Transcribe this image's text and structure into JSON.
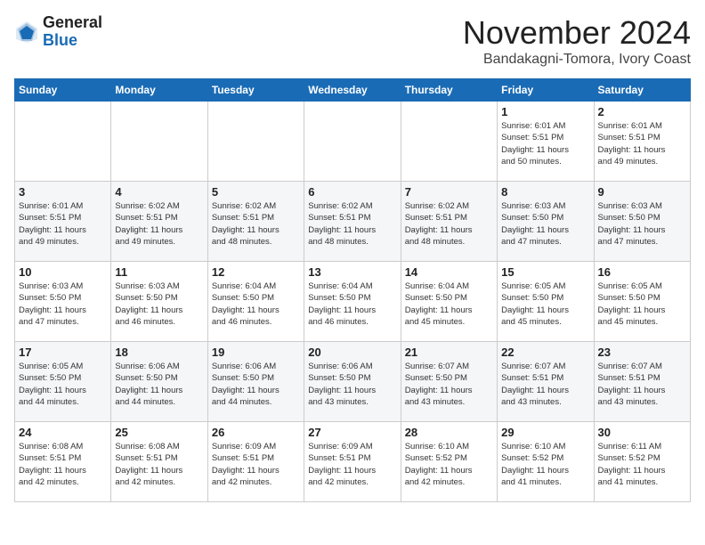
{
  "header": {
    "logo_general": "General",
    "logo_blue": "Blue",
    "month_title": "November 2024",
    "location": "Bandakagni-Tomora, Ivory Coast"
  },
  "weekdays": [
    "Sunday",
    "Monday",
    "Tuesday",
    "Wednesday",
    "Thursday",
    "Friday",
    "Saturday"
  ],
  "weeks": [
    [
      {
        "day": "",
        "info": ""
      },
      {
        "day": "",
        "info": ""
      },
      {
        "day": "",
        "info": ""
      },
      {
        "day": "",
        "info": ""
      },
      {
        "day": "",
        "info": ""
      },
      {
        "day": "1",
        "info": "Sunrise: 6:01 AM\nSunset: 5:51 PM\nDaylight: 11 hours\nand 50 minutes."
      },
      {
        "day": "2",
        "info": "Sunrise: 6:01 AM\nSunset: 5:51 PM\nDaylight: 11 hours\nand 49 minutes."
      }
    ],
    [
      {
        "day": "3",
        "info": "Sunrise: 6:01 AM\nSunset: 5:51 PM\nDaylight: 11 hours\nand 49 minutes."
      },
      {
        "day": "4",
        "info": "Sunrise: 6:02 AM\nSunset: 5:51 PM\nDaylight: 11 hours\nand 49 minutes."
      },
      {
        "day": "5",
        "info": "Sunrise: 6:02 AM\nSunset: 5:51 PM\nDaylight: 11 hours\nand 48 minutes."
      },
      {
        "day": "6",
        "info": "Sunrise: 6:02 AM\nSunset: 5:51 PM\nDaylight: 11 hours\nand 48 minutes."
      },
      {
        "day": "7",
        "info": "Sunrise: 6:02 AM\nSunset: 5:51 PM\nDaylight: 11 hours\nand 48 minutes."
      },
      {
        "day": "8",
        "info": "Sunrise: 6:03 AM\nSunset: 5:50 PM\nDaylight: 11 hours\nand 47 minutes."
      },
      {
        "day": "9",
        "info": "Sunrise: 6:03 AM\nSunset: 5:50 PM\nDaylight: 11 hours\nand 47 minutes."
      }
    ],
    [
      {
        "day": "10",
        "info": "Sunrise: 6:03 AM\nSunset: 5:50 PM\nDaylight: 11 hours\nand 47 minutes."
      },
      {
        "day": "11",
        "info": "Sunrise: 6:03 AM\nSunset: 5:50 PM\nDaylight: 11 hours\nand 46 minutes."
      },
      {
        "day": "12",
        "info": "Sunrise: 6:04 AM\nSunset: 5:50 PM\nDaylight: 11 hours\nand 46 minutes."
      },
      {
        "day": "13",
        "info": "Sunrise: 6:04 AM\nSunset: 5:50 PM\nDaylight: 11 hours\nand 46 minutes."
      },
      {
        "day": "14",
        "info": "Sunrise: 6:04 AM\nSunset: 5:50 PM\nDaylight: 11 hours\nand 45 minutes."
      },
      {
        "day": "15",
        "info": "Sunrise: 6:05 AM\nSunset: 5:50 PM\nDaylight: 11 hours\nand 45 minutes."
      },
      {
        "day": "16",
        "info": "Sunrise: 6:05 AM\nSunset: 5:50 PM\nDaylight: 11 hours\nand 45 minutes."
      }
    ],
    [
      {
        "day": "17",
        "info": "Sunrise: 6:05 AM\nSunset: 5:50 PM\nDaylight: 11 hours\nand 44 minutes."
      },
      {
        "day": "18",
        "info": "Sunrise: 6:06 AM\nSunset: 5:50 PM\nDaylight: 11 hours\nand 44 minutes."
      },
      {
        "day": "19",
        "info": "Sunrise: 6:06 AM\nSunset: 5:50 PM\nDaylight: 11 hours\nand 44 minutes."
      },
      {
        "day": "20",
        "info": "Sunrise: 6:06 AM\nSunset: 5:50 PM\nDaylight: 11 hours\nand 43 minutes."
      },
      {
        "day": "21",
        "info": "Sunrise: 6:07 AM\nSunset: 5:50 PM\nDaylight: 11 hours\nand 43 minutes."
      },
      {
        "day": "22",
        "info": "Sunrise: 6:07 AM\nSunset: 5:51 PM\nDaylight: 11 hours\nand 43 minutes."
      },
      {
        "day": "23",
        "info": "Sunrise: 6:07 AM\nSunset: 5:51 PM\nDaylight: 11 hours\nand 43 minutes."
      }
    ],
    [
      {
        "day": "24",
        "info": "Sunrise: 6:08 AM\nSunset: 5:51 PM\nDaylight: 11 hours\nand 42 minutes."
      },
      {
        "day": "25",
        "info": "Sunrise: 6:08 AM\nSunset: 5:51 PM\nDaylight: 11 hours\nand 42 minutes."
      },
      {
        "day": "26",
        "info": "Sunrise: 6:09 AM\nSunset: 5:51 PM\nDaylight: 11 hours\nand 42 minutes."
      },
      {
        "day": "27",
        "info": "Sunrise: 6:09 AM\nSunset: 5:51 PM\nDaylight: 11 hours\nand 42 minutes."
      },
      {
        "day": "28",
        "info": "Sunrise: 6:10 AM\nSunset: 5:52 PM\nDaylight: 11 hours\nand 42 minutes."
      },
      {
        "day": "29",
        "info": "Sunrise: 6:10 AM\nSunset: 5:52 PM\nDaylight: 11 hours\nand 41 minutes."
      },
      {
        "day": "30",
        "info": "Sunrise: 6:11 AM\nSunset: 5:52 PM\nDaylight: 11 hours\nand 41 minutes."
      }
    ]
  ]
}
